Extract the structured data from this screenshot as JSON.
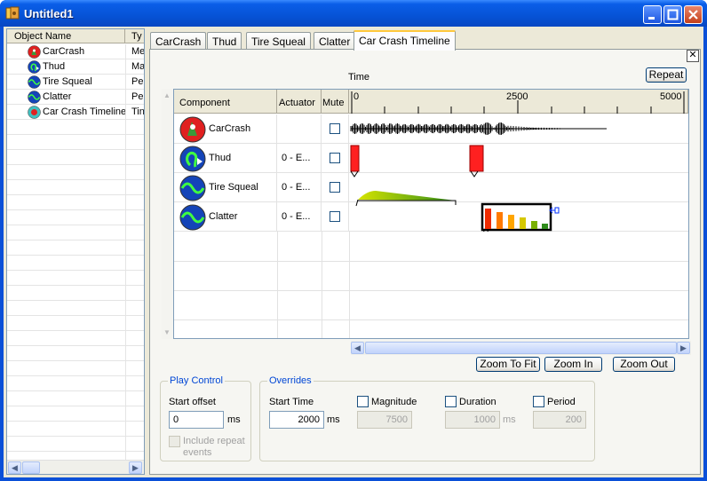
{
  "window": {
    "title": "Untitled1"
  },
  "object_list": {
    "col_name": "Object Name",
    "col_type": "Ty",
    "items": [
      {
        "name": "CarCrash",
        "type": "Me",
        "icon": "carcrash-icon"
      },
      {
        "name": "Thud",
        "type": "Ma",
        "icon": "thud-icon"
      },
      {
        "name": "Tire Squeal",
        "type": "Pe",
        "icon": "tire-squeal-icon"
      },
      {
        "name": "Clatter",
        "type": "Pe",
        "icon": "clatter-icon"
      },
      {
        "name": "Car Crash Timeline",
        "type": "Tin",
        "icon": "timeline-icon"
      }
    ]
  },
  "tabs": [
    "CarCrash",
    "Thud",
    "Tire Squeal",
    "Clatter",
    "Car Crash Timeline"
  ],
  "active_tab": "Car Crash Timeline",
  "timeline": {
    "repeat_label": "Repeat",
    "time_label": "Time",
    "col_component": "Component",
    "col_actuator": "Actuator",
    "col_mute": "Mute",
    "ruler": [
      "0",
      "2500",
      "5000"
    ],
    "rows": [
      {
        "name": "CarCrash",
        "actuator": "",
        "icon": "carcrash-icon"
      },
      {
        "name": "Thud",
        "actuator": "0 - E...",
        "icon": "thud-icon"
      },
      {
        "name": "Tire Squeal",
        "actuator": "0 - E...",
        "icon": "tire-squeal-icon"
      },
      {
        "name": "Clatter",
        "actuator": "0 - E...",
        "icon": "clatter-icon"
      }
    ],
    "zoom_to_fit": "Zoom To Fit",
    "zoom_in": "Zoom In",
    "zoom_out": "Zoom Out"
  },
  "play_control": {
    "title": "Play Control",
    "start_offset_label": "Start offset",
    "start_offset_value": "0",
    "unit": "ms",
    "include_repeat_label": "Include repeat events"
  },
  "overrides": {
    "title": "Overrides",
    "start_time_label": "Start Time",
    "start_time_value": "2000",
    "start_time_unit": "ms",
    "magnitude_label": "Magnitude",
    "magnitude_value": "7500",
    "duration_label": "Duration",
    "duration_value": "1000",
    "duration_unit": "ms",
    "period_label": "Period",
    "period_value": "200"
  },
  "colors": {
    "titlebar": "#0653d6",
    "event_red": "#ff2020",
    "tab_highlight": "#ffc83c"
  }
}
